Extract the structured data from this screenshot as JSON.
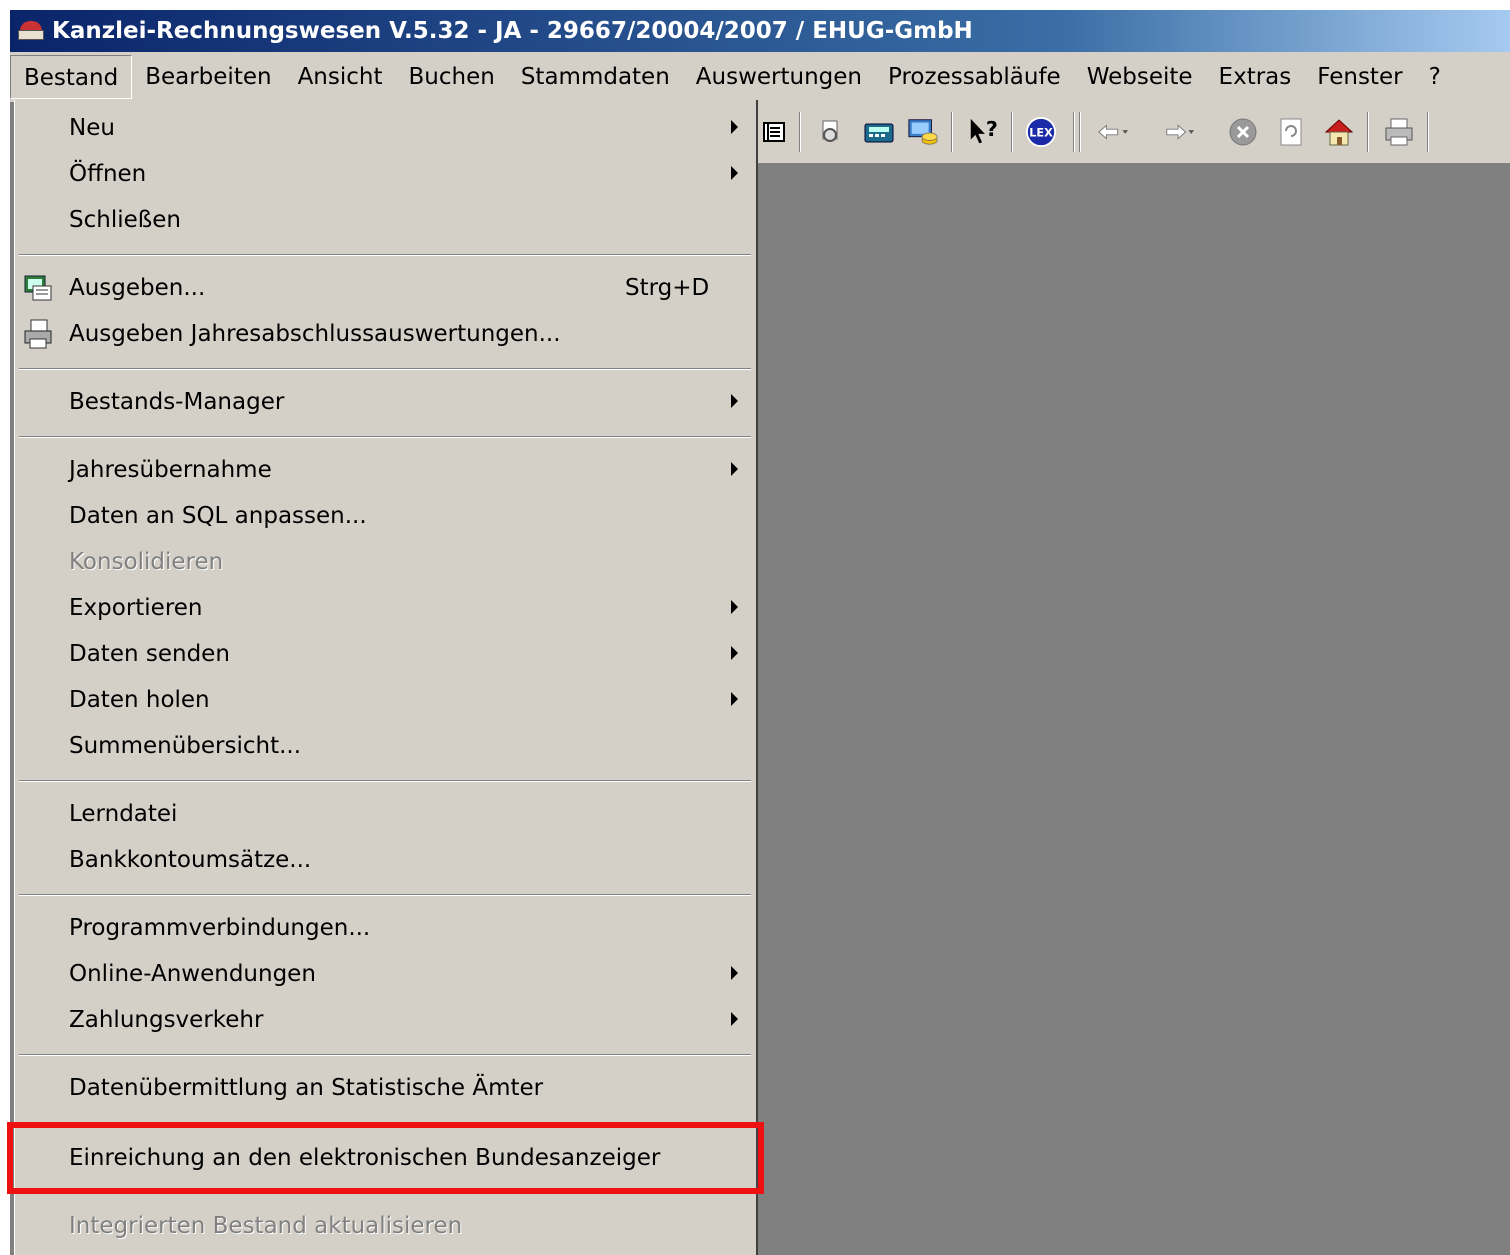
{
  "window": {
    "title": "Kanzlei-Rechnungswesen V.5.32 - JA - 29667/20004/2007 / EHUG-GmbH"
  },
  "menubar": {
    "items": [
      {
        "label": "Bestand"
      },
      {
        "label": "Bearbeiten"
      },
      {
        "label": "Ansicht"
      },
      {
        "label": "Buchen"
      },
      {
        "label": "Stammdaten"
      },
      {
        "label": "Auswertungen"
      },
      {
        "label": "Prozessabläufe"
      },
      {
        "label": "Webseite"
      },
      {
        "label": "Extras"
      },
      {
        "label": "Fenster"
      },
      {
        "label": "?"
      }
    ]
  },
  "toolbar": {
    "buttons": [
      "list-icon",
      "print-preview-icon",
      "calculator-icon",
      "computer-coins-icon",
      "help-pointer-icon",
      "lex-icon",
      "back-icon",
      "forward-icon",
      "stop-icon",
      "refresh-icon",
      "home-icon",
      "print-icon"
    ],
    "lex_label": "LEX"
  },
  "dropdown": {
    "items": [
      {
        "label": "Neu",
        "submenu": true,
        "enabled": true
      },
      {
        "label": "Öffnen",
        "submenu": true,
        "enabled": true
      },
      {
        "label": "Schließen",
        "enabled": true
      },
      {
        "label": "Ausgeben...",
        "shortcut": "Strg+D",
        "icon": "output-icon",
        "enabled": true
      },
      {
        "label": "Ausgeben Jahresabschlussauswertungen...",
        "icon": "printer-icon",
        "enabled": true
      },
      {
        "label": "Bestands-Manager",
        "submenu": true,
        "enabled": true
      },
      {
        "label": "Jahresübernahme",
        "submenu": true,
        "enabled": true
      },
      {
        "label": "Daten an SQL anpassen...",
        "enabled": true
      },
      {
        "label": "Konsolidieren",
        "enabled": false
      },
      {
        "label": "Exportieren",
        "submenu": true,
        "enabled": true
      },
      {
        "label": "Daten senden",
        "submenu": true,
        "enabled": true
      },
      {
        "label": "Daten holen",
        "submenu": true,
        "enabled": true
      },
      {
        "label": "Summenübersicht...",
        "enabled": true
      },
      {
        "label": "Lerndatei",
        "enabled": true
      },
      {
        "label": "Bankkontoumsätze...",
        "enabled": true
      },
      {
        "label": "Programmverbindungen...",
        "enabled": true
      },
      {
        "label": "Online-Anwendungen",
        "submenu": true,
        "enabled": true
      },
      {
        "label": "Zahlungsverkehr",
        "submenu": true,
        "enabled": true
      },
      {
        "label": "Datenübermittlung an Statistische Ämter",
        "enabled": true
      },
      {
        "label": "Einreichung an den elektronischen Bundesanzeiger",
        "enabled": true,
        "highlighted": true
      },
      {
        "label": "Integrierten Bestand aktualisieren",
        "enabled": false
      }
    ]
  },
  "colors": {
    "highlight_box": "#ee1111",
    "menu_bg": "#d4d0c8",
    "workspace": "#808080",
    "title_start": "#0a246a",
    "title_end": "#a6caf0"
  }
}
